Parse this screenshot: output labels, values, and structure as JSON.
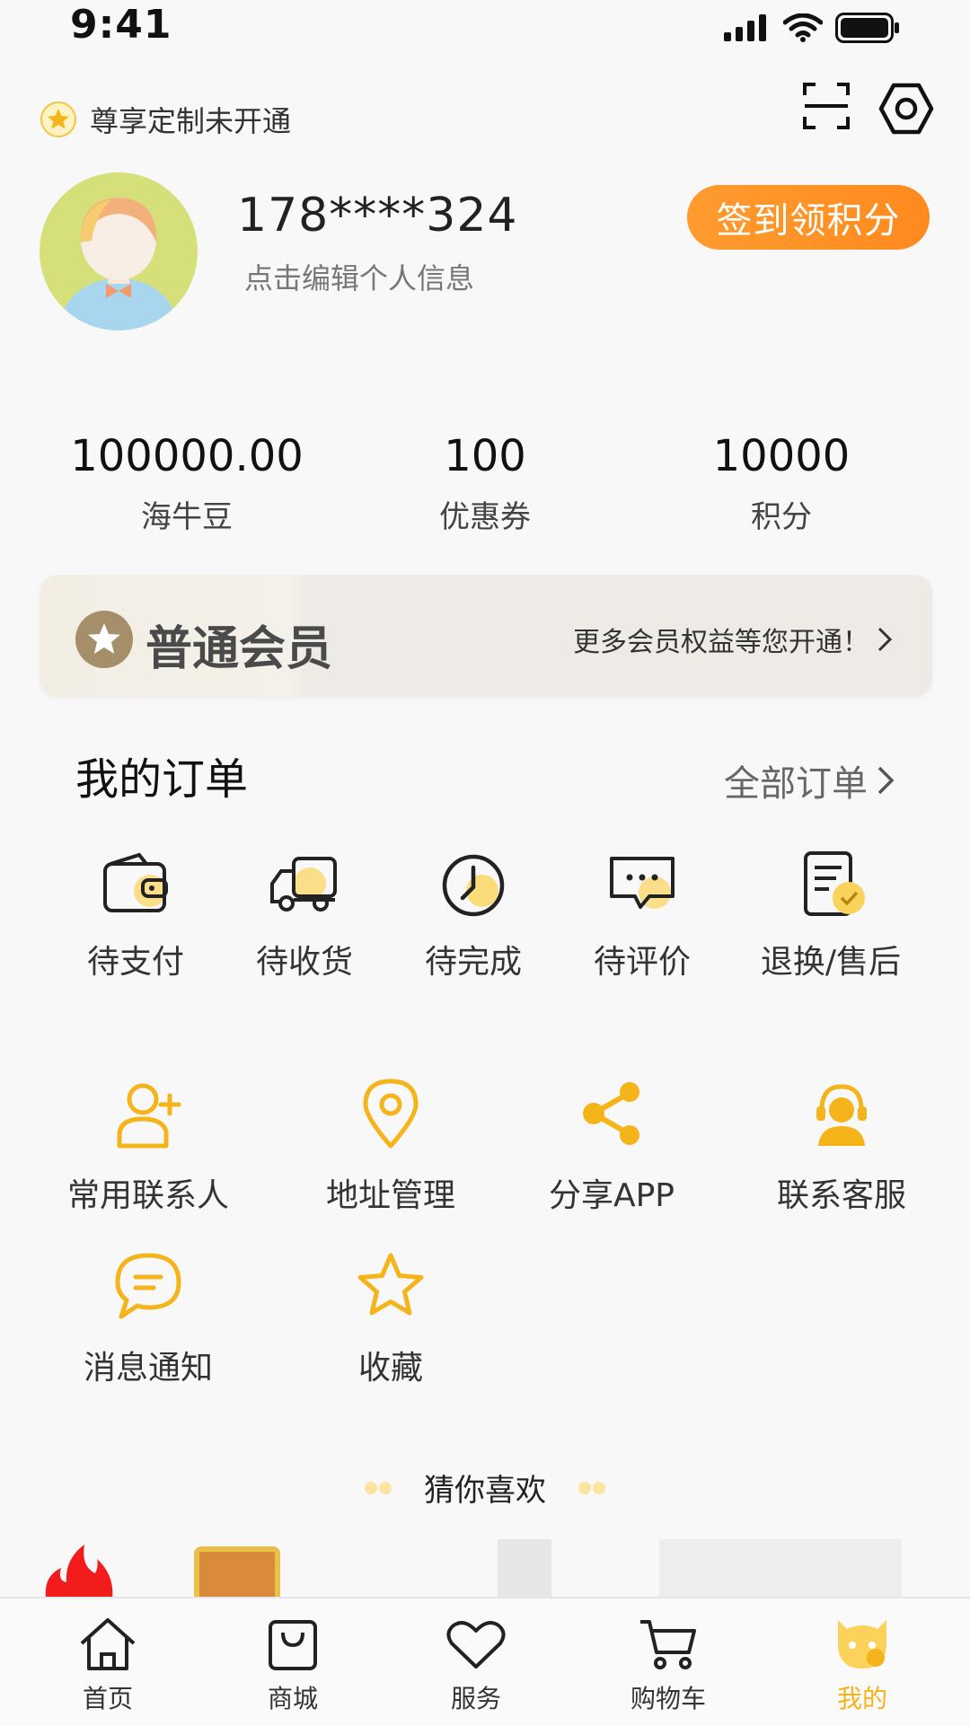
{
  "status_bar": {
    "time": "9:41"
  },
  "header": {
    "vip_status": "尊享定制未开通",
    "phone": "178****324",
    "edit_hint": "点击编辑个人信息",
    "checkin_label": "签到领积分"
  },
  "stats": [
    {
      "value": "100000.00",
      "label": "海牛豆"
    },
    {
      "value": "100",
      "label": "优惠券"
    },
    {
      "value": "10000",
      "label": "积分"
    }
  ],
  "membership": {
    "level": "普通会员",
    "promo": "更多会员权益等您开通！"
  },
  "orders": {
    "title": "我的订单",
    "all_label": "全部订单",
    "items": [
      {
        "label": "待支付",
        "icon": "wallet-icon"
      },
      {
        "label": "待收货",
        "icon": "truck-icon"
      },
      {
        "label": "待完成",
        "icon": "clock-icon"
      },
      {
        "label": "待评价",
        "icon": "comment-icon"
      },
      {
        "label": "退换/售后",
        "icon": "document-check-icon"
      }
    ]
  },
  "services": [
    {
      "label": "常用联系人",
      "icon": "add-contact-icon"
    },
    {
      "label": "地址管理",
      "icon": "location-pin-icon"
    },
    {
      "label": "分享APP",
      "icon": "share-icon"
    },
    {
      "label": "联系客服",
      "icon": "customer-service-icon"
    },
    {
      "label": "消息通知",
      "icon": "message-icon"
    },
    {
      "label": "收藏",
      "icon": "star-icon"
    }
  ],
  "recommend": {
    "title": "猜你喜欢"
  },
  "tabbar": [
    {
      "label": "首页",
      "icon": "home-icon"
    },
    {
      "label": "商城",
      "icon": "shopping-bag-icon"
    },
    {
      "label": "服务",
      "icon": "heart-icon"
    },
    {
      "label": "购物车",
      "icon": "cart-icon"
    },
    {
      "label": "我的",
      "icon": "profile-icon",
      "active": true
    }
  ],
  "colors": {
    "accent": "#f4b41a",
    "checkin": "#ff9226",
    "member_badge": "#a58e6a"
  }
}
